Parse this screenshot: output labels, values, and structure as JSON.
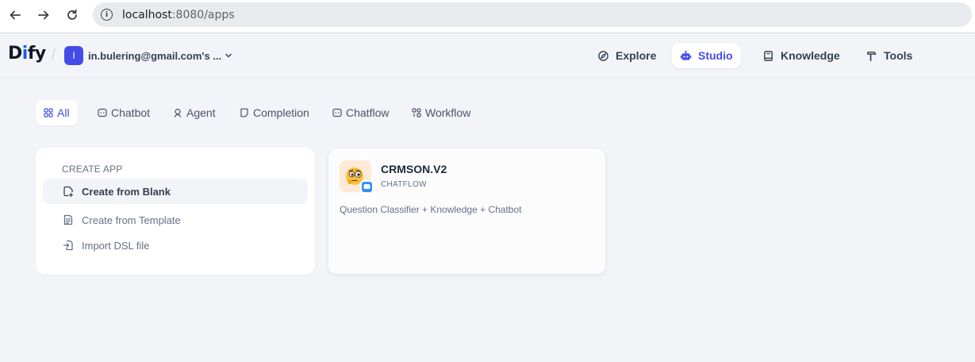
{
  "browser": {
    "url_host": "localhost",
    "url_path": ":8080/apps"
  },
  "header": {
    "logo": {
      "main": "D",
      "accent": "i",
      "rest": "fy"
    },
    "workspace": {
      "avatar_letter": "I",
      "name": "in.bulering@gmail.com's ..."
    },
    "nav": [
      {
        "label": "Explore",
        "icon": "compass-icon"
      },
      {
        "label": "Studio",
        "icon": "robot-icon",
        "active": true
      },
      {
        "label": "Knowledge",
        "icon": "book-icon"
      },
      {
        "label": "Tools",
        "icon": "hammer-icon"
      }
    ]
  },
  "tabs": [
    {
      "label": "All",
      "icon": "grid-icon",
      "active": true
    },
    {
      "label": "Chatbot",
      "icon": "chat-bubble-icon"
    },
    {
      "label": "Agent",
      "icon": "agent-icon"
    },
    {
      "label": "Completion",
      "icon": "file-text-icon"
    },
    {
      "label": "Chatflow",
      "icon": "chat-flow-icon"
    },
    {
      "label": "Workflow",
      "icon": "workflow-icon"
    }
  ],
  "create_app": {
    "title": "CREATE APP",
    "items": [
      {
        "label": "Create from Blank",
        "icon": "file-plus-icon"
      },
      {
        "label": "Create from Template",
        "icon": "template-icon"
      },
      {
        "label": "Import DSL file",
        "icon": "file-import-icon"
      }
    ]
  },
  "apps": [
    {
      "name": "CRMSON.V2",
      "type": "CHATFLOW",
      "description": "Question Classifier + Knowledge + Chatbot",
      "icon": "thinking-face-emoji",
      "badge_icon": "chat-badge-icon",
      "icon_bg": "#fdead7"
    }
  ],
  "colors": {
    "accent": "#444ce7",
    "page_bg": "#f2f4f7"
  }
}
